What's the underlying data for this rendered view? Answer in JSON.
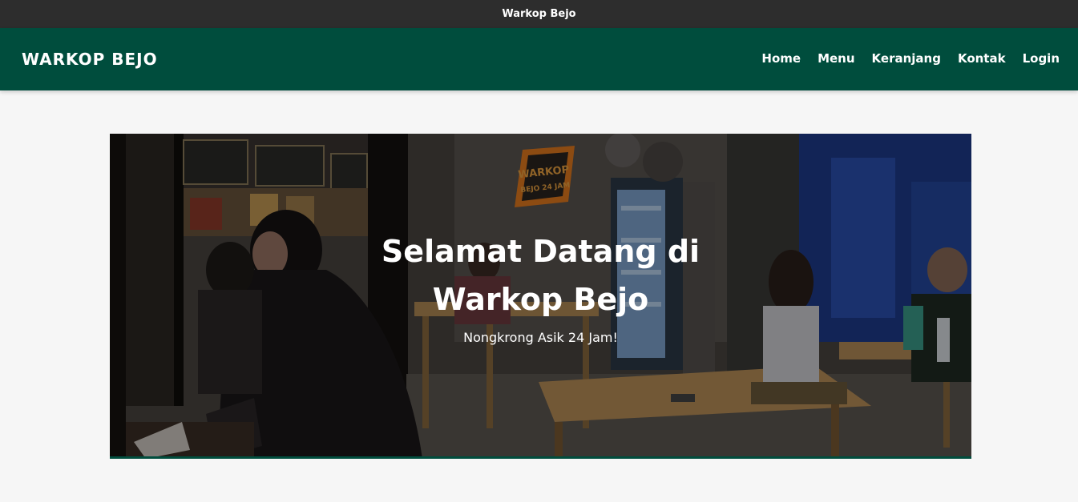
{
  "window": {
    "title": "Warkop Bejo"
  },
  "header": {
    "brand": "WARKOP BEJO",
    "nav": [
      {
        "label": "Home"
      },
      {
        "label": "Menu"
      },
      {
        "label": "Keranjang"
      },
      {
        "label": "Kontak"
      },
      {
        "label": "Login"
      }
    ]
  },
  "hero": {
    "title": "Selamat Datang di Warkop Bejo",
    "subtitle": "Nongkrong Asik 24 Jam!",
    "sign_text": [
      "WARKOP",
      "BEJO 24 JAM"
    ]
  },
  "colors": {
    "titlebar": "#2d2d2d",
    "navbar": "#004d3d",
    "page_bg": "#f6f6f6",
    "text": "#ffffff"
  }
}
